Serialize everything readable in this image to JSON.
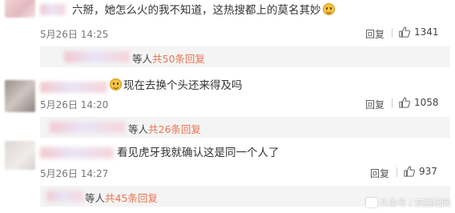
{
  "comments": [
    {
      "text": "六掰，她怎么火的我不知道，这热搜都上的莫名其妙",
      "time": "5月26日 14:25",
      "reply_label": "回复",
      "likes": "1341",
      "thread": {
        "suffix": "等人",
        "count_text": "共50条回复"
      }
    },
    {
      "text": "现在去换个头还来得及吗",
      "time": "5月26日 14:20",
      "reply_label": "回复",
      "likes": "1058",
      "thread": {
        "suffix": "等人",
        "count_text": "共26条回复"
      }
    },
    {
      "text": "看见虎牙我就确认这是同一个人了",
      "time": "5月26日 14:27",
      "reply_label": "回复",
      "likes": "937",
      "thread": {
        "suffix": "等人",
        "count_text": "共45条回复"
      }
    }
  ],
  "watermark": "头条号 / 热推配网",
  "icons": {
    "like": "thumbs-up-icon",
    "emoji": "smiley-emoji-icon"
  },
  "colors": {
    "reply_count": "#eb7350",
    "thread_bg": "#f4f4f4"
  }
}
